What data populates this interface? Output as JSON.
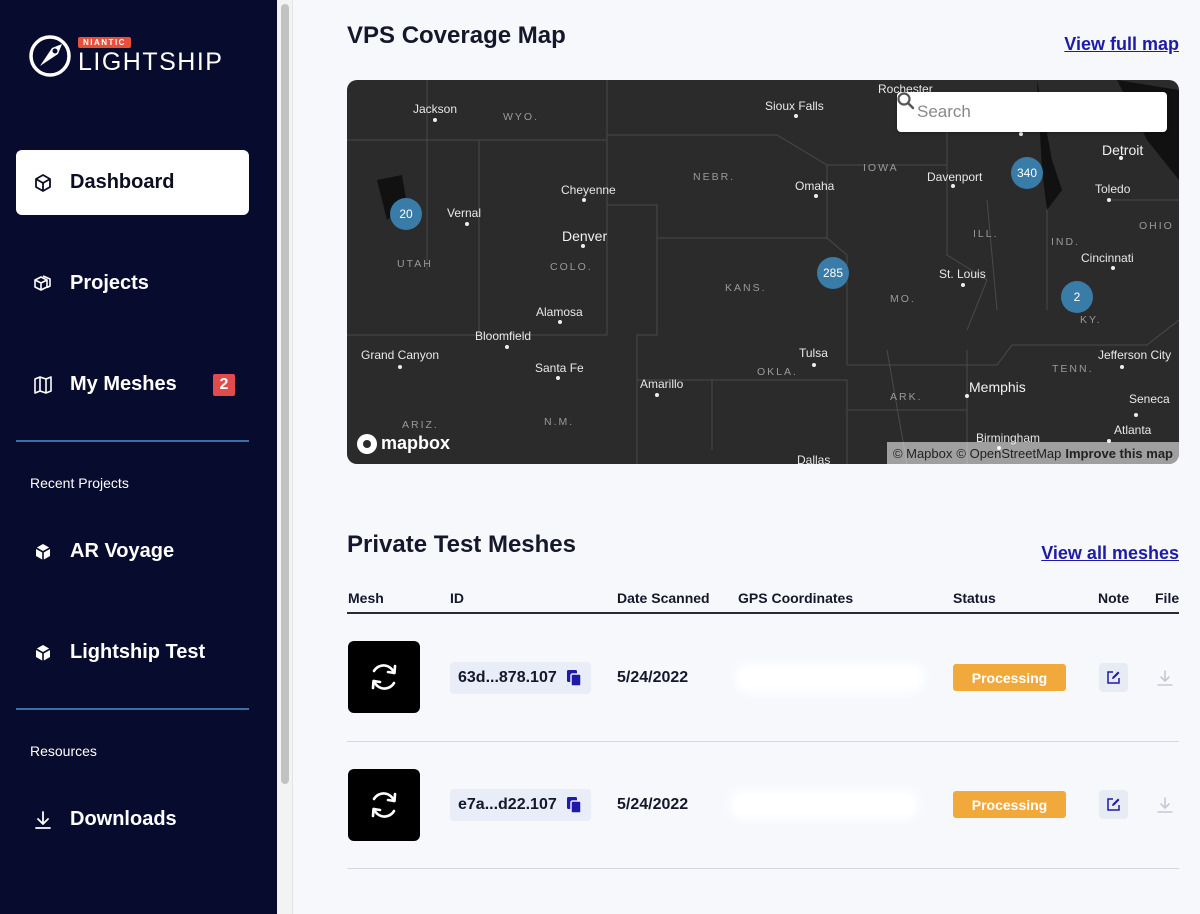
{
  "brand": {
    "badge": "NIANTIC",
    "name": "LIGHTSHIP"
  },
  "sidebar": {
    "items": [
      {
        "label": "Dashboard",
        "icon": "cube-icon"
      },
      {
        "label": "Projects",
        "icon": "cubes-icon"
      },
      {
        "label": "My Meshes",
        "icon": "map-icon",
        "badge": "2"
      }
    ],
    "recent_label": "Recent Projects",
    "recent": [
      {
        "label": "AR Voyage",
        "icon": "project-cube-icon"
      },
      {
        "label": "Lightship Test",
        "icon": "project-cube-icon"
      }
    ],
    "resources_label": "Resources",
    "resources": [
      {
        "label": "Downloads",
        "icon": "download-icon"
      }
    ]
  },
  "coverage": {
    "title": "VPS Coverage Map",
    "link": "View full map",
    "search_placeholder": "Search",
    "attribution": {
      "mapbox": "© Mapbox",
      "osm": "© OpenStreetMap",
      "improve": "Improve this map"
    },
    "logo": "mapbox",
    "cities": [
      "Rochester",
      "Jackson",
      "Sioux Falls",
      "Detroit",
      "Omaha",
      "Davenport",
      "Toledo",
      "Cheyenne",
      "Vernal",
      "Denver",
      "Cincinnati",
      "St. Louis",
      "Alamosa",
      "Bloomfield",
      "Grand Canyon",
      "Santa Fe",
      "Tulsa",
      "Jefferson City",
      "Amarillo",
      "Memphis",
      "Seneca",
      "Birmingham",
      "Atlanta",
      "Dallas"
    ],
    "states": [
      "WYO.",
      "NEBR.",
      "IOWA",
      "ILL.",
      "IND.",
      "OHIO",
      "UTAH",
      "COLO.",
      "KANS.",
      "MO.",
      "KY.",
      "OKLA.",
      "TENN.",
      "ARK.",
      "ARIZ.",
      "N.M."
    ],
    "clusters": [
      "20",
      "340",
      "285",
      "2"
    ]
  },
  "meshes": {
    "title": "Private Test Meshes",
    "link": "View all meshes",
    "columns": [
      "Mesh",
      "ID",
      "Date Scanned",
      "GPS Coordinates",
      "Status",
      "Note",
      "File"
    ],
    "rows": [
      {
        "id": "63d...878.107",
        "date": "5/24/2022",
        "status": "Processing"
      },
      {
        "id": "e7a...d22.107",
        "date": "5/24/2022",
        "status": "Processing"
      }
    ]
  }
}
